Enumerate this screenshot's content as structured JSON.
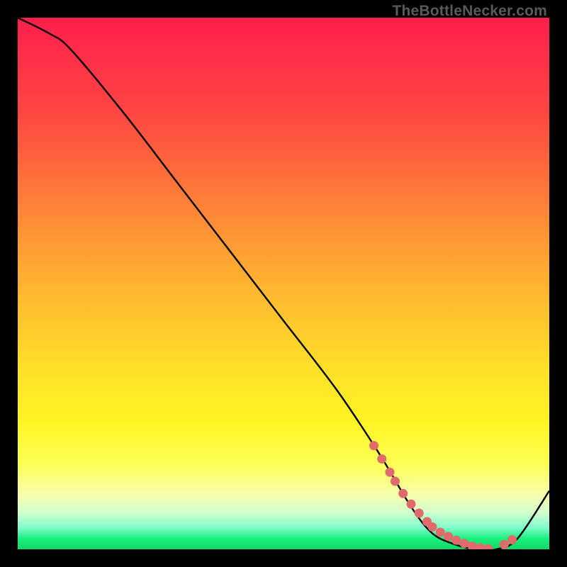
{
  "watermark": "TheBottleNecker.com",
  "chart_data": {
    "type": "line",
    "title": "",
    "xlabel": "",
    "ylabel": "",
    "xlim": [
      0,
      100
    ],
    "ylim": [
      0,
      100
    ],
    "series": [
      {
        "name": "curve",
        "x": [
          0,
          6,
          10,
          20,
          30,
          40,
          50,
          60,
          68,
          74,
          78,
          82,
          86,
          90,
          94,
          100
        ],
        "y": [
          100,
          97,
          94,
          82,
          69,
          56,
          43,
          30,
          18,
          8,
          3,
          1,
          0,
          0,
          2,
          11
        ]
      }
    ],
    "markers": {
      "name": "highlight-dots",
      "color": "#e16a6a",
      "x": [
        67.0,
        68.5,
        70.0,
        71.0,
        72.5,
        74.0,
        75.5,
        77.0,
        78.0,
        79.5,
        81.0,
        82.5,
        84.0,
        85.5,
        87.0,
        88.5,
        91.5,
        93.0
      ],
      "y": [
        19.5,
        17.0,
        14.5,
        12.8,
        10.5,
        8.5,
        6.8,
        5.2,
        4.2,
        3.2,
        2.4,
        1.7,
        1.1,
        0.6,
        0.3,
        0.1,
        0.9,
        1.8
      ]
    },
    "gradient_stops": [
      {
        "pos": 0.0,
        "color": "#ff1e4a"
      },
      {
        "pos": 0.3,
        "color": "#ff6f3a"
      },
      {
        "pos": 0.6,
        "color": "#ffe028"
      },
      {
        "pos": 0.9,
        "color": "#f5ffb0"
      },
      {
        "pos": 1.0,
        "color": "#0fd867"
      }
    ]
  }
}
